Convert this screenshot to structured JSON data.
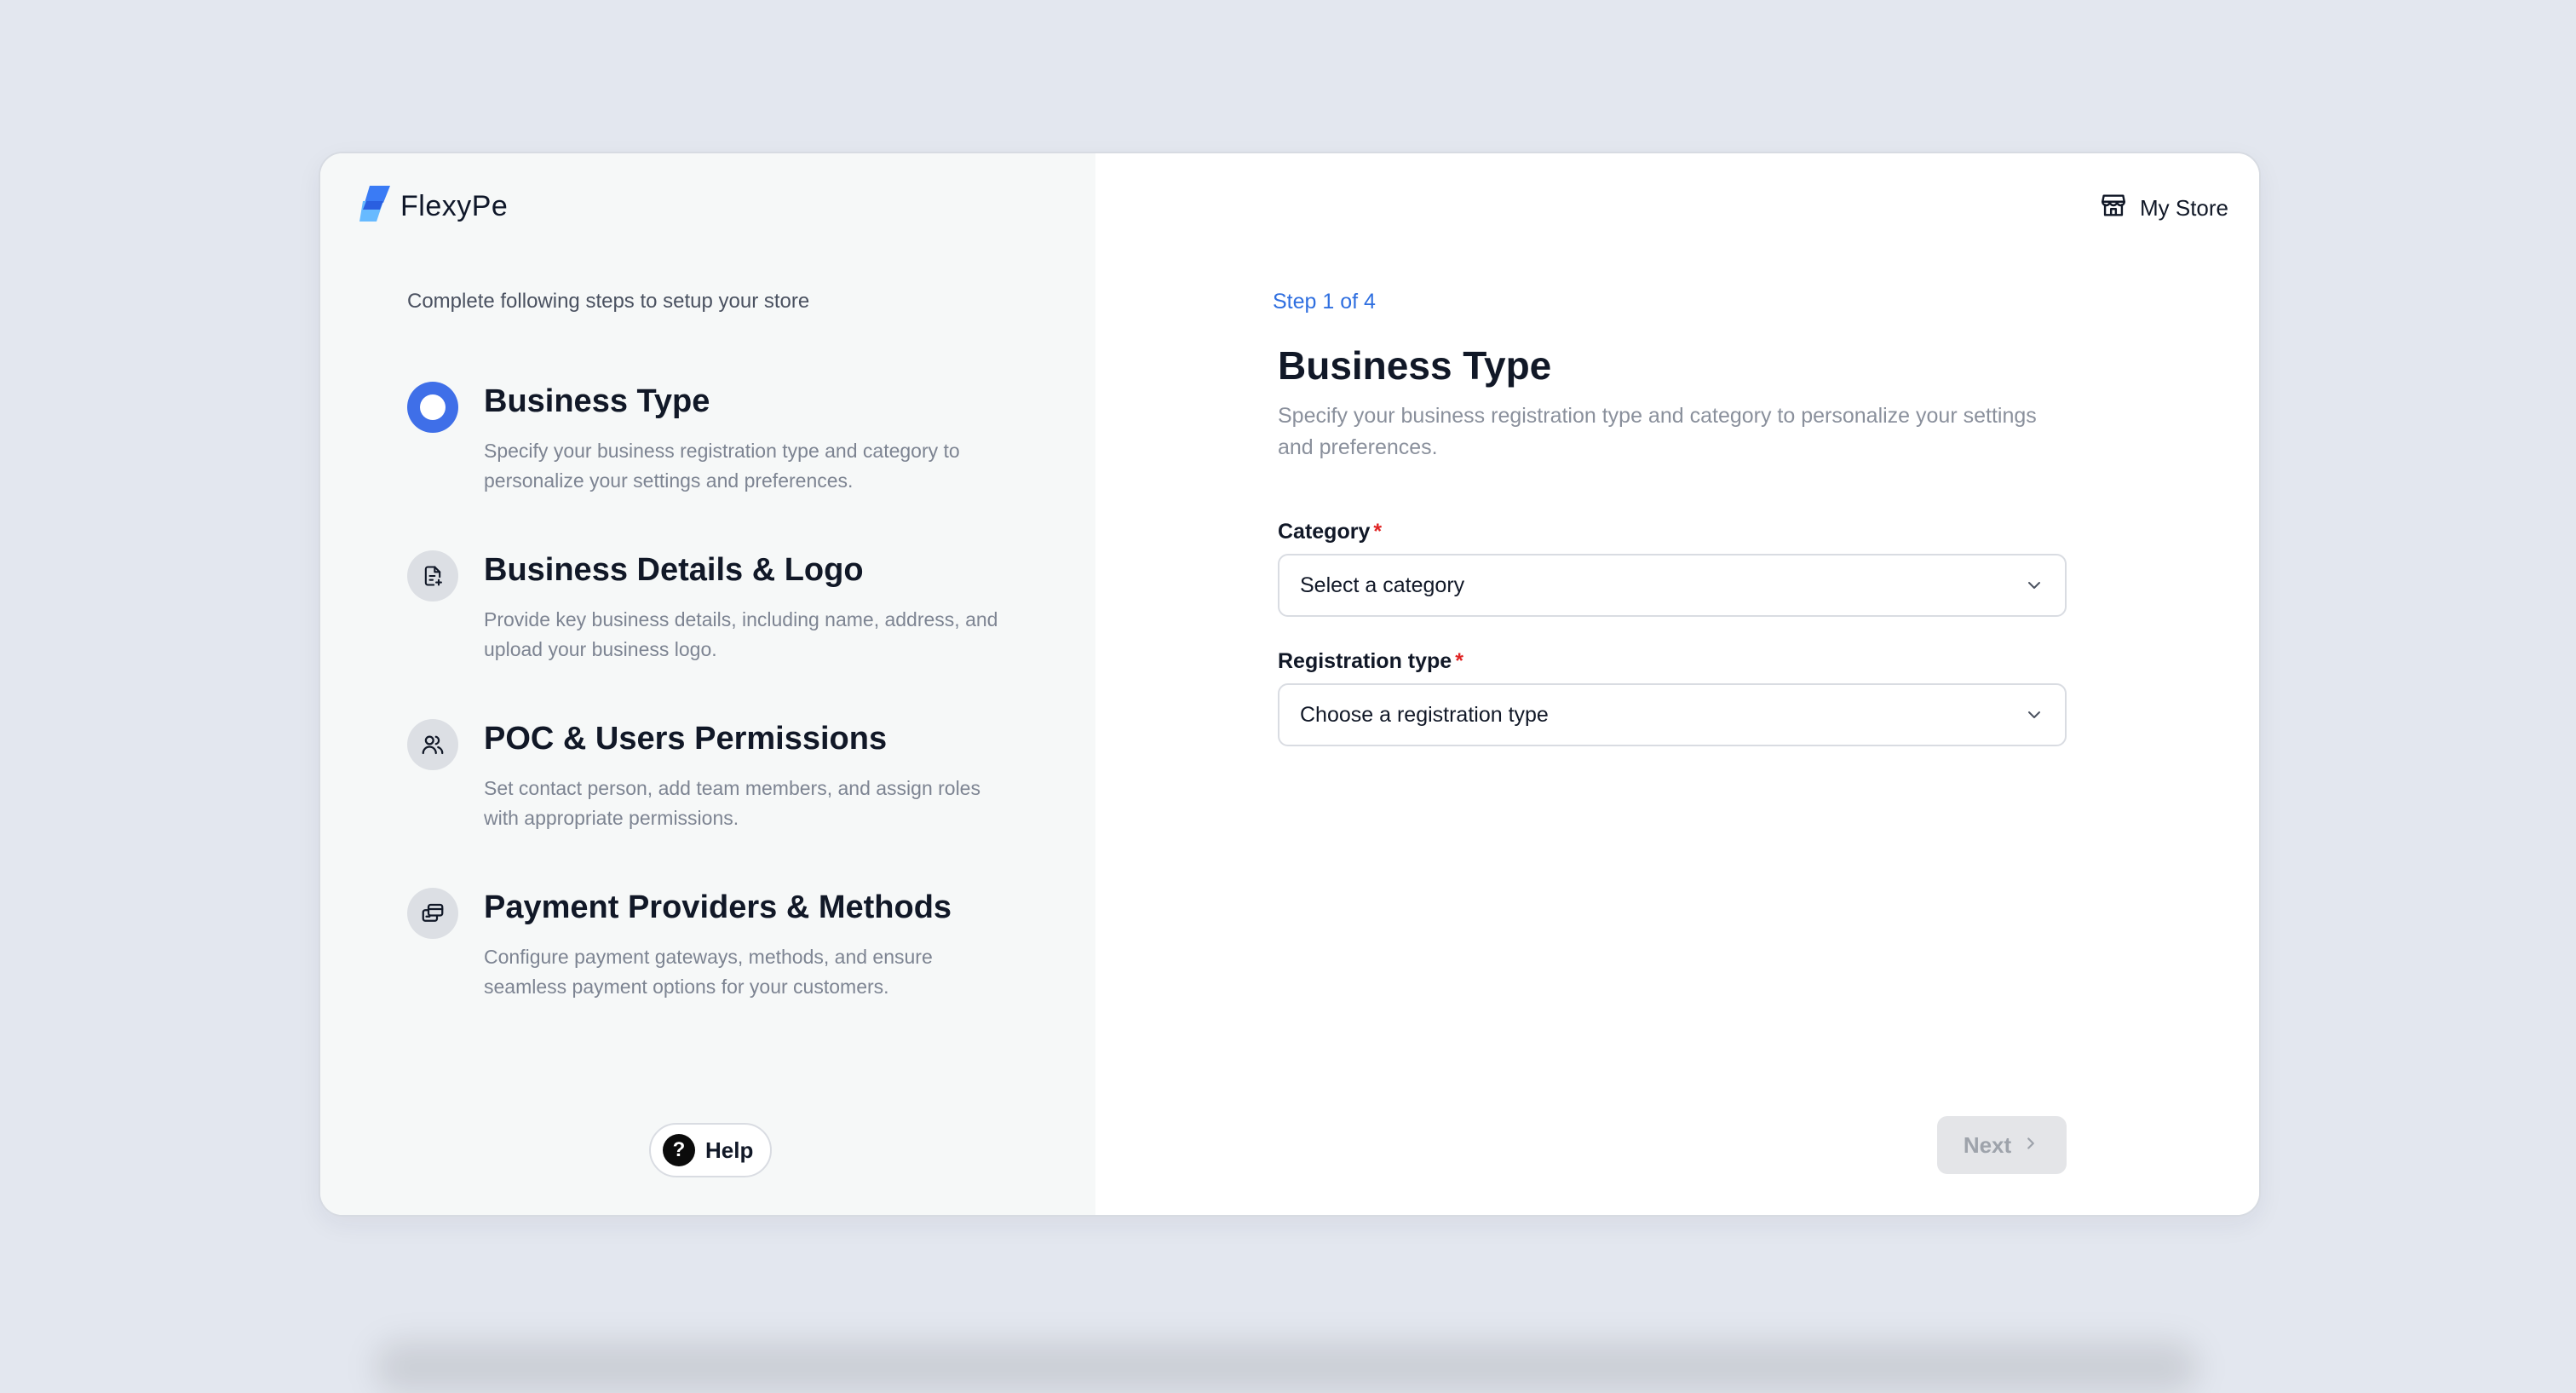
{
  "brand": {
    "name": "FlexyPe"
  },
  "header": {
    "store_label": "My Store"
  },
  "sidebar": {
    "intro": "Complete following steps to setup your store",
    "steps": [
      {
        "title": "Business Type",
        "description": "Specify your business registration type and category to personalize your settings and preferences.",
        "icon": "radio-active-icon",
        "active": true
      },
      {
        "title": "Business Details & Logo",
        "description": "Provide key business details, including name, address, and upload your business logo.",
        "icon": "document-icon",
        "active": false
      },
      {
        "title": "POC & Users Permissions",
        "description": "Set contact person, add team members, and assign roles with appropriate permissions.",
        "icon": "users-icon",
        "active": false
      },
      {
        "title": "Payment Providers & Methods",
        "description": "Configure payment gateways, methods, and ensure seamless payment options for your customers.",
        "icon": "payment-icon",
        "active": false
      }
    ],
    "help_label": "Help",
    "help_icon_glyph": "?"
  },
  "main": {
    "step_label": "Step 1 of 4",
    "title": "Business Type",
    "description": "Specify your business registration type and category to personalize your settings and preferences.",
    "category": {
      "label": "Category",
      "required_mark": "*",
      "placeholder": "Select a category"
    },
    "registration": {
      "label": "Registration type",
      "required_mark": "*",
      "placeholder": "Choose a registration type"
    },
    "next_label": "Next"
  },
  "colors": {
    "accent": "#3f6fe8",
    "step_label": "#2f6fe0",
    "required": "#e02424",
    "background": "#e3e7ef"
  }
}
